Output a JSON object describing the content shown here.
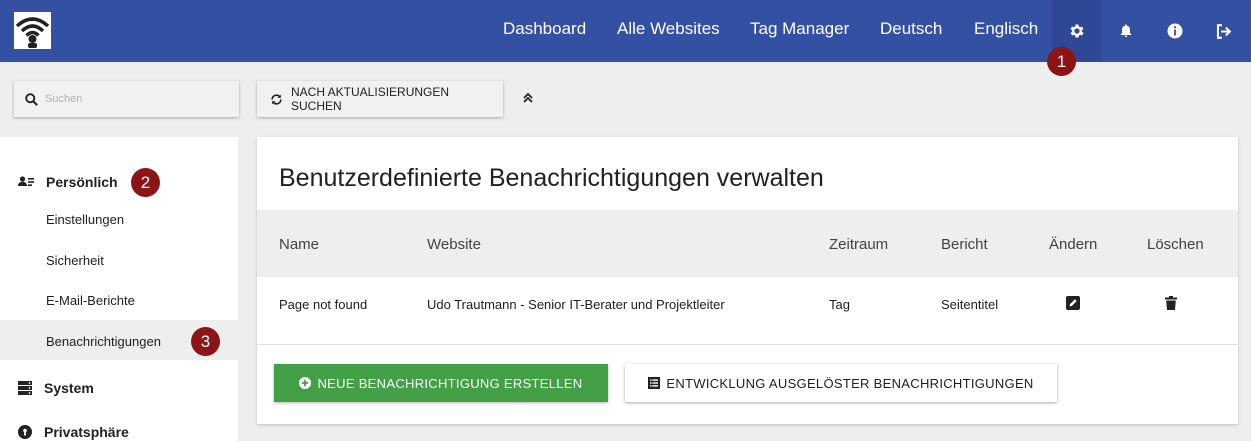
{
  "topbar": {
    "logo_icon": "wifi-user-logo",
    "links": [
      "Dashboard",
      "Alle Websites",
      "Tag Manager",
      "Deutsch",
      "Englisch"
    ],
    "icons": [
      "gear-icon",
      "bell-icon",
      "info-icon",
      "logout-icon"
    ],
    "accent": "#3450a3"
  },
  "badges": [
    "1",
    "2",
    "3"
  ],
  "search": {
    "placeholder": "Suchen",
    "value": ""
  },
  "toolbar": {
    "update_label": "NACH AKTUALISIERUNGEN SUCHEN"
  },
  "sidebar": {
    "personal": "Persönlich",
    "items": [
      "Einstellungen",
      "Sicherheit",
      "E-Mail-Berichte",
      "Benachrichtigungen"
    ],
    "system": "System",
    "privacy": "Privatsphäre"
  },
  "main": {
    "title": "Benutzerdefinierte Benachrichtigungen verwalten",
    "columns": [
      "Name",
      "Website",
      "Zeitraum",
      "Bericht",
      "Ändern",
      "Löschen"
    ],
    "rows": [
      {
        "name": "Page not found",
        "website": "Udo Trautmann - Senior IT-Berater und Projektleiter",
        "period": "Tag",
        "report": "Seitentitel"
      }
    ],
    "create_button": "NEUE BENACHRICHTIGUNG ERSTELLEN",
    "history_button": "ENTWICKLUNG AUSGELÖSTER BENACHRICHTIGUNGEN",
    "green": "#43a047",
    "badge_color": "#8c1414"
  }
}
